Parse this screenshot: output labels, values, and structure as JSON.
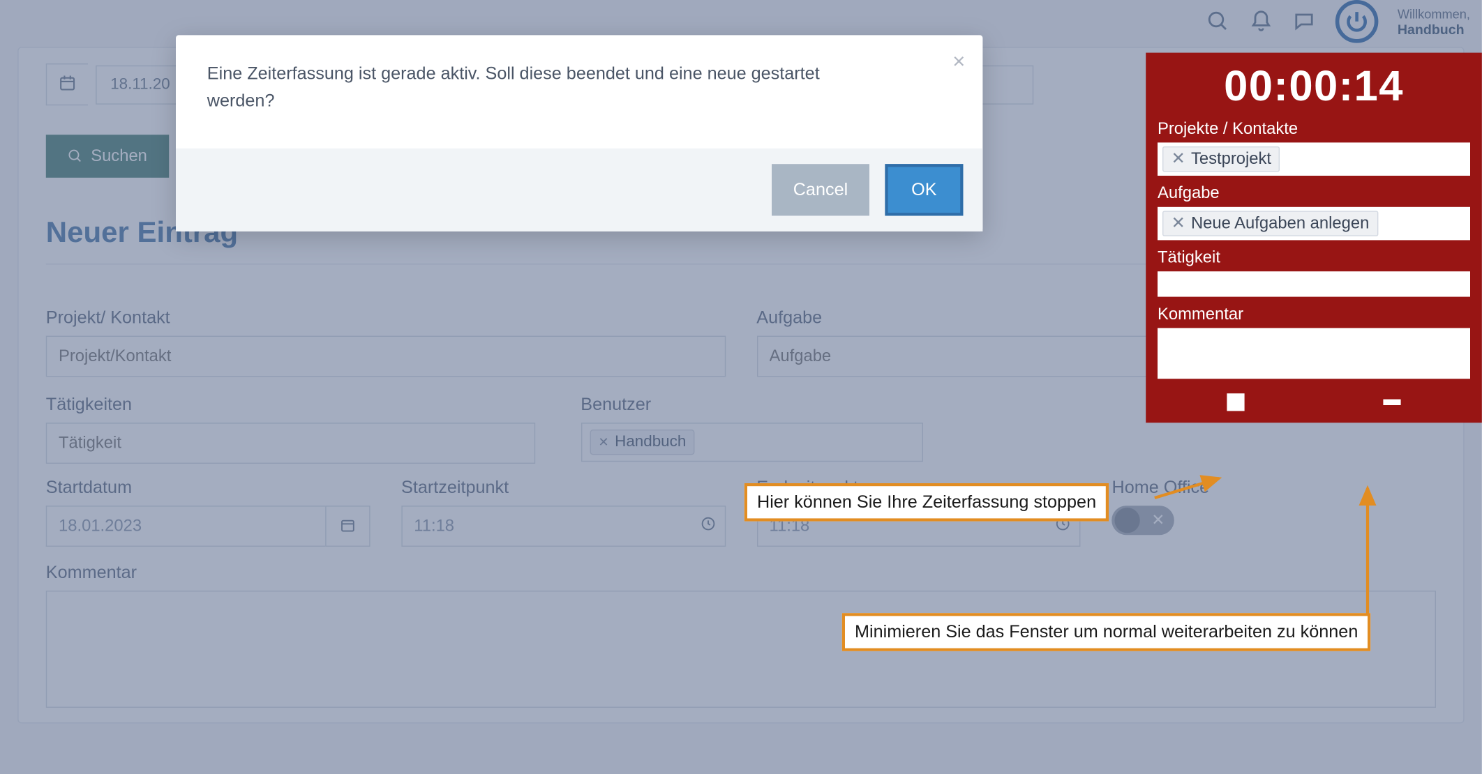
{
  "header": {
    "welcome_prefix": "Willkommen,",
    "username": "Handbuch"
  },
  "main": {
    "date_value": "18.11.20",
    "search_label": "Suchen",
    "section_title": "Neuer Eintrag",
    "labels": {
      "project": "Projekt/ Kontakt",
      "task": "Aufgabe",
      "activities": "Tätigkeiten",
      "user": "Benutzer",
      "startdate": "Startdatum",
      "starttime": "Startzeitpunkt",
      "endtime": "Endzeitpunkt",
      "homeoffice": "Home Office",
      "comment": "Kommentar"
    },
    "placeholders": {
      "project": "Projekt/Kontakt",
      "task": "Aufgabe",
      "activity": "Tätigkeit"
    },
    "values": {
      "user_tag": "Handbuch",
      "startdate": "18.01.2023",
      "starttime": "11:18",
      "endtime": "11:18"
    }
  },
  "modal": {
    "message": "Eine Zeiterfassung ist gerade aktiv. Soll diese beendet und eine neue gestartet werden?",
    "cancel": "Cancel",
    "ok": "OK"
  },
  "timer": {
    "time": "00:00:14",
    "labels": {
      "projects": "Projekte / Kontakte",
      "task": "Aufgabe",
      "activity": "Tätigkeit",
      "comment": "Kommentar"
    },
    "project_tag": "Testprojekt",
    "task_tag": "Neue Aufgaben anlegen"
  },
  "annotations": {
    "stop": "Hier können Sie Ihre Zeiterfassung stoppen",
    "minimize": "Minimieren Sie das Fenster um normal weiterarbeiten zu können"
  }
}
